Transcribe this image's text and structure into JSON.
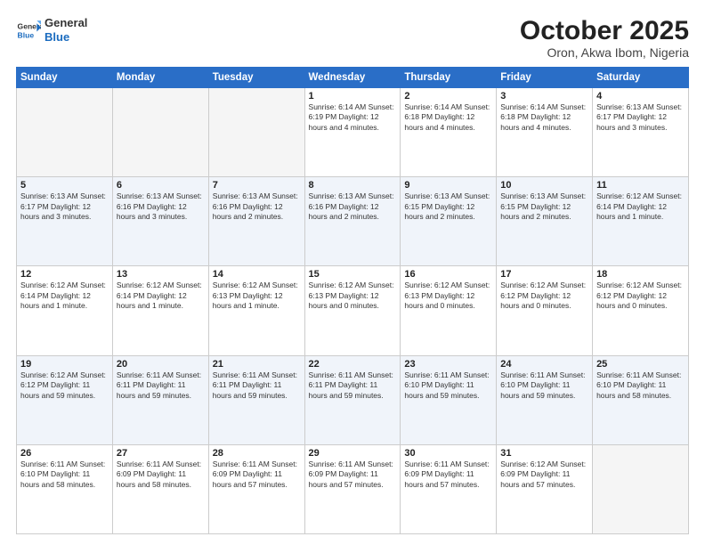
{
  "logo": {
    "line1": "General",
    "line2": "Blue"
  },
  "title": "October 2025",
  "subtitle": "Oron, Akwa Ibom, Nigeria",
  "weekdays": [
    "Sunday",
    "Monday",
    "Tuesday",
    "Wednesday",
    "Thursday",
    "Friday",
    "Saturday"
  ],
  "weeks": [
    [
      {
        "day": "",
        "info": ""
      },
      {
        "day": "",
        "info": ""
      },
      {
        "day": "",
        "info": ""
      },
      {
        "day": "1",
        "info": "Sunrise: 6:14 AM\nSunset: 6:19 PM\nDaylight: 12 hours\nand 4 minutes."
      },
      {
        "day": "2",
        "info": "Sunrise: 6:14 AM\nSunset: 6:18 PM\nDaylight: 12 hours\nand 4 minutes."
      },
      {
        "day": "3",
        "info": "Sunrise: 6:14 AM\nSunset: 6:18 PM\nDaylight: 12 hours\nand 4 minutes."
      },
      {
        "day": "4",
        "info": "Sunrise: 6:13 AM\nSunset: 6:17 PM\nDaylight: 12 hours\nand 3 minutes."
      }
    ],
    [
      {
        "day": "5",
        "info": "Sunrise: 6:13 AM\nSunset: 6:17 PM\nDaylight: 12 hours\nand 3 minutes."
      },
      {
        "day": "6",
        "info": "Sunrise: 6:13 AM\nSunset: 6:16 PM\nDaylight: 12 hours\nand 3 minutes."
      },
      {
        "day": "7",
        "info": "Sunrise: 6:13 AM\nSunset: 6:16 PM\nDaylight: 12 hours\nand 2 minutes."
      },
      {
        "day": "8",
        "info": "Sunrise: 6:13 AM\nSunset: 6:16 PM\nDaylight: 12 hours\nand 2 minutes."
      },
      {
        "day": "9",
        "info": "Sunrise: 6:13 AM\nSunset: 6:15 PM\nDaylight: 12 hours\nand 2 minutes."
      },
      {
        "day": "10",
        "info": "Sunrise: 6:13 AM\nSunset: 6:15 PM\nDaylight: 12 hours\nand 2 minutes."
      },
      {
        "day": "11",
        "info": "Sunrise: 6:12 AM\nSunset: 6:14 PM\nDaylight: 12 hours\nand 1 minute."
      }
    ],
    [
      {
        "day": "12",
        "info": "Sunrise: 6:12 AM\nSunset: 6:14 PM\nDaylight: 12 hours\nand 1 minute."
      },
      {
        "day": "13",
        "info": "Sunrise: 6:12 AM\nSunset: 6:14 PM\nDaylight: 12 hours\nand 1 minute."
      },
      {
        "day": "14",
        "info": "Sunrise: 6:12 AM\nSunset: 6:13 PM\nDaylight: 12 hours\nand 1 minute."
      },
      {
        "day": "15",
        "info": "Sunrise: 6:12 AM\nSunset: 6:13 PM\nDaylight: 12 hours\nand 0 minutes."
      },
      {
        "day": "16",
        "info": "Sunrise: 6:12 AM\nSunset: 6:13 PM\nDaylight: 12 hours\nand 0 minutes."
      },
      {
        "day": "17",
        "info": "Sunrise: 6:12 AM\nSunset: 6:12 PM\nDaylight: 12 hours\nand 0 minutes."
      },
      {
        "day": "18",
        "info": "Sunrise: 6:12 AM\nSunset: 6:12 PM\nDaylight: 12 hours\nand 0 minutes."
      }
    ],
    [
      {
        "day": "19",
        "info": "Sunrise: 6:12 AM\nSunset: 6:12 PM\nDaylight: 11 hours\nand 59 minutes."
      },
      {
        "day": "20",
        "info": "Sunrise: 6:11 AM\nSunset: 6:11 PM\nDaylight: 11 hours\nand 59 minutes."
      },
      {
        "day": "21",
        "info": "Sunrise: 6:11 AM\nSunset: 6:11 PM\nDaylight: 11 hours\nand 59 minutes."
      },
      {
        "day": "22",
        "info": "Sunrise: 6:11 AM\nSunset: 6:11 PM\nDaylight: 11 hours\nand 59 minutes."
      },
      {
        "day": "23",
        "info": "Sunrise: 6:11 AM\nSunset: 6:10 PM\nDaylight: 11 hours\nand 59 minutes."
      },
      {
        "day": "24",
        "info": "Sunrise: 6:11 AM\nSunset: 6:10 PM\nDaylight: 11 hours\nand 59 minutes."
      },
      {
        "day": "25",
        "info": "Sunrise: 6:11 AM\nSunset: 6:10 PM\nDaylight: 11 hours\nand 58 minutes."
      }
    ],
    [
      {
        "day": "26",
        "info": "Sunrise: 6:11 AM\nSunset: 6:10 PM\nDaylight: 11 hours\nand 58 minutes."
      },
      {
        "day": "27",
        "info": "Sunrise: 6:11 AM\nSunset: 6:09 PM\nDaylight: 11 hours\nand 58 minutes."
      },
      {
        "day": "28",
        "info": "Sunrise: 6:11 AM\nSunset: 6:09 PM\nDaylight: 11 hours\nand 57 minutes."
      },
      {
        "day": "29",
        "info": "Sunrise: 6:11 AM\nSunset: 6:09 PM\nDaylight: 11 hours\nand 57 minutes."
      },
      {
        "day": "30",
        "info": "Sunrise: 6:11 AM\nSunset: 6:09 PM\nDaylight: 11 hours\nand 57 minutes."
      },
      {
        "day": "31",
        "info": "Sunrise: 6:12 AM\nSunset: 6:09 PM\nDaylight: 11 hours\nand 57 minutes."
      },
      {
        "day": "",
        "info": ""
      }
    ]
  ]
}
